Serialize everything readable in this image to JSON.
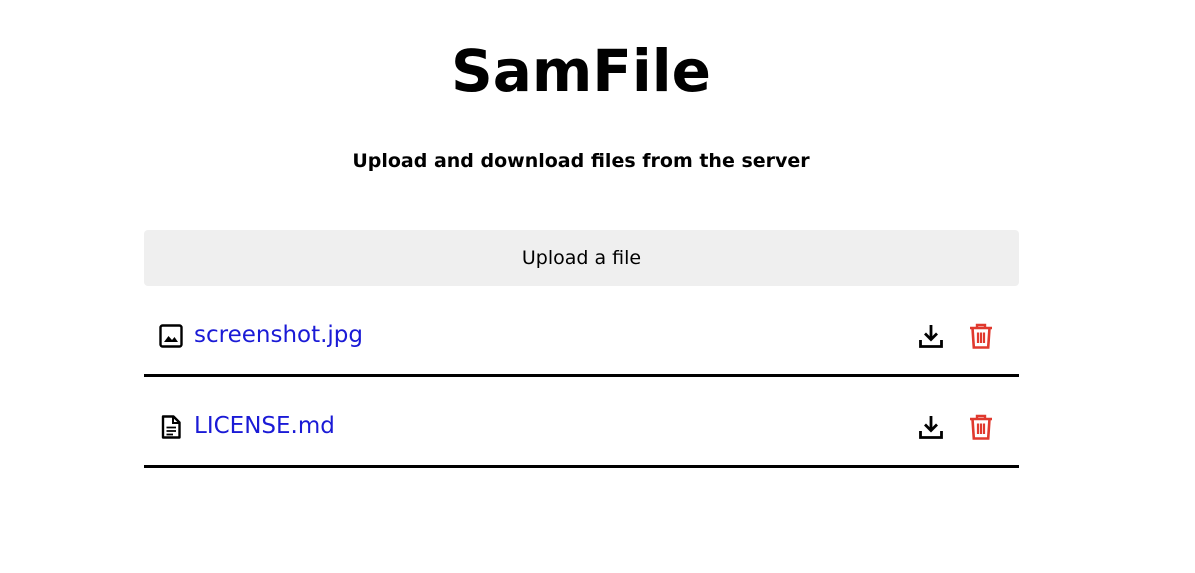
{
  "header": {
    "title": "SamFile",
    "subtitle": "Upload and download files from the server"
  },
  "upload": {
    "label": "Upload a file"
  },
  "files": [
    {
      "name": "screenshot.jpg",
      "icon": "image-file-icon"
    },
    {
      "name": "LICENSE.md",
      "icon": "text-file-icon"
    }
  ],
  "colors": {
    "link": "#1a1ad6",
    "delete": "#e0392e",
    "upload_bg": "#efefef"
  }
}
